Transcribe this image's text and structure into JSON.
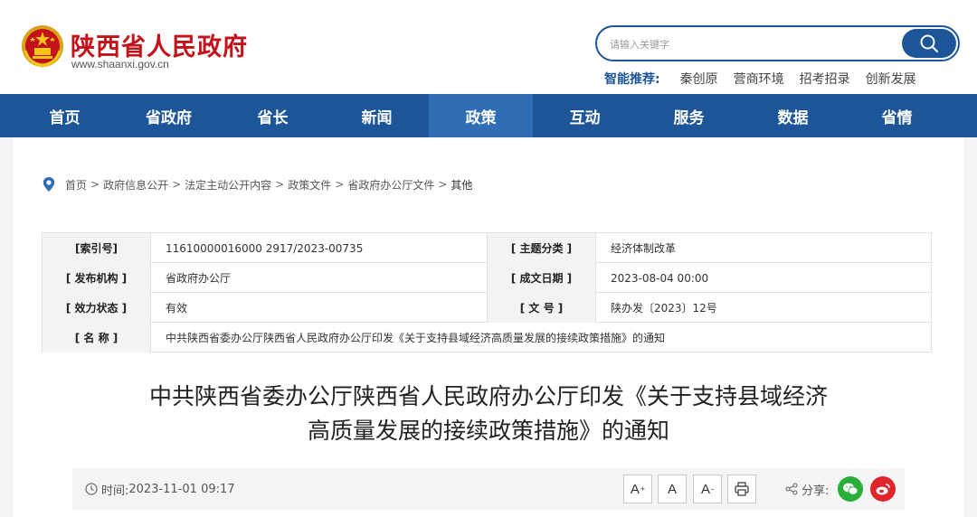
{
  "site": {
    "name": "陕西省人民政府",
    "url": "www.shaanxi.gov.cn"
  },
  "search": {
    "placeholder": "请输入关键字"
  },
  "hot": {
    "label": "智能推荐:",
    "links": [
      "秦创原",
      "营商环境",
      "招考招录",
      "创新发展"
    ]
  },
  "nav": {
    "items": [
      "首页",
      "省政府",
      "省长",
      "新闻",
      "政策",
      "互动",
      "服务",
      "数据",
      "省情"
    ],
    "active": "政策"
  },
  "breadcrumb": {
    "items": [
      "首页",
      "政府信息公开",
      "法定主动公开内容",
      "政策文件",
      "省政府办公厅文件",
      "其他"
    ],
    "separator": ">"
  },
  "meta": {
    "index_label": "[索引号]",
    "index_value": "11610000016000 2917/2023-00735",
    "topic_label": "[ 主题分类 ]",
    "topic_value": "经济体制改革",
    "issuer_label": "[ 发布机构 ]",
    "issuer_value": "省政府办公厅",
    "date_label": "[ 成文日期 ]",
    "date_value": "2023-08-04 00:00",
    "status_label": "[ 效力状态 ]",
    "status_value": "有效",
    "docno_label": "[ 文 号 ]",
    "docno_value": "陕办发〔2023〕12号",
    "name_label": "[ 名 称 ]",
    "name_value": "中共陕西省委办公厅陕西省人民政府办公厅印发《关于支持县域经济高质量发展的接续政策措施》的通知"
  },
  "article": {
    "title_line1": "中共陕西省委办公厅陕西省人民政府办公厅印发《关于支持县域经济",
    "title_line2": "高质量发展的接续政策措施》的通知",
    "time_label": "时间:",
    "time_value": "2023-11-01 09:17",
    "font_larger": "A",
    "font_normal": "A",
    "font_smaller": "A",
    "share_label": "分享:"
  },
  "colors": {
    "brand_blue": "#1d5599",
    "nav_active": "#2f6db4",
    "title_red": "#c4121a",
    "wechat_green": "#2aae3a",
    "weibo_red": "#e0262b"
  }
}
